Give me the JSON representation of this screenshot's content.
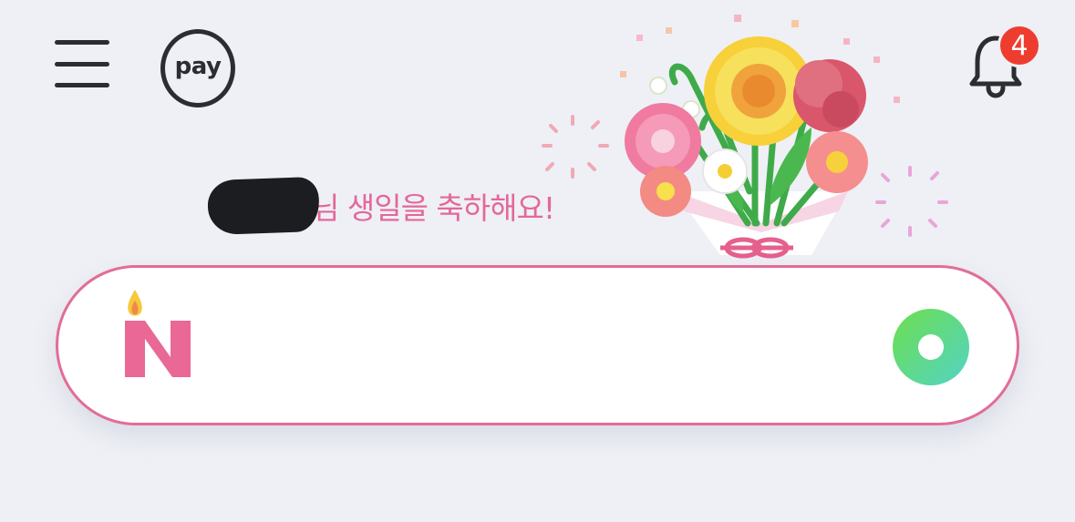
{
  "header": {
    "pay_label": "pay",
    "notification_count": "4"
  },
  "greeting": {
    "message": "님 생일을 축하해요!"
  },
  "colors": {
    "background": "#eef0f5",
    "accent_pink": "#e4679b",
    "badge_red": "#ee3d2f",
    "icon_dark": "#2b2d31",
    "search_green": "#5fd86a"
  },
  "icons": [
    "menu-icon",
    "pay-icon",
    "bell-icon",
    "bouquet-illustration",
    "naver-birthday-logo",
    "green-circle-icon"
  ]
}
